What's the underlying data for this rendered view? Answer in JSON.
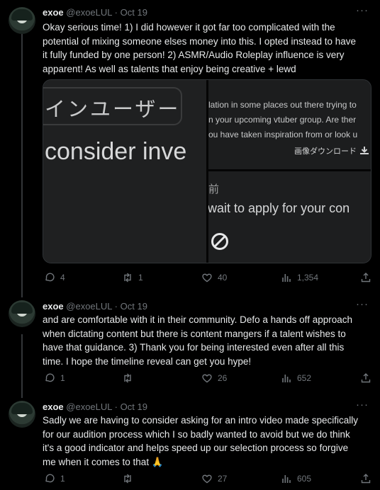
{
  "tweets": [
    {
      "name": "exoe",
      "handle": "@exoeLUL",
      "sep": "·",
      "date": "Oct 19",
      "more": "···",
      "lines": [
        "Okay serious time! 1) I did however it got far too complicated with the",
        "potential of mixing someone elses money into this. I opted instead to have",
        "it fully funded by one person! 2) ASMR/Audio Roleplay influence is very",
        "apparent! As well as talents that enjoy being creative + lewd"
      ],
      "replies": "4",
      "retweets": "1",
      "likes": "40",
      "views": "1,354"
    },
    {
      "name": "exoe",
      "handle": "@exoeLUL",
      "sep": "·",
      "date": "Oct 19",
      "more": "···",
      "lines": [
        "and are comfortable with it in their community. Defo a hands off approach",
        "when dictating content but there is content mangers if a talent wishes to",
        "have that guidance. 3) Thank you for being interested even after all this",
        "time. I hope the timeline reveal can get you hype!"
      ],
      "replies": "1",
      "retweets": "",
      "likes": "26",
      "views": "652"
    },
    {
      "name": "exoe",
      "handle": "@exoeLUL",
      "sep": "·",
      "date": "Oct 19",
      "more": "···",
      "lines": [
        "Sadly we are having to consider asking for an intro video made specifically",
        "for our audition process which I so badly wanted to avoid but we do think",
        "it's a good indicator and helps speed up our selection process so forgive",
        "me when it comes to that 🙏"
      ],
      "replies": "1",
      "retweets": "",
      "likes": "27",
      "views": "605"
    }
  ],
  "media": {
    "jp_text": "インユーザー",
    "left_text": "consider inve",
    "top_right_lines": [
      "lation in some places out there trying to",
      "n your upcoming vtuber group. Are ther",
      "ou have taken inspiration from or look u"
    ],
    "download_label": "画像ダウンロード",
    "kanji": "前",
    "bottom_right_text": "wait to apply for your con"
  }
}
